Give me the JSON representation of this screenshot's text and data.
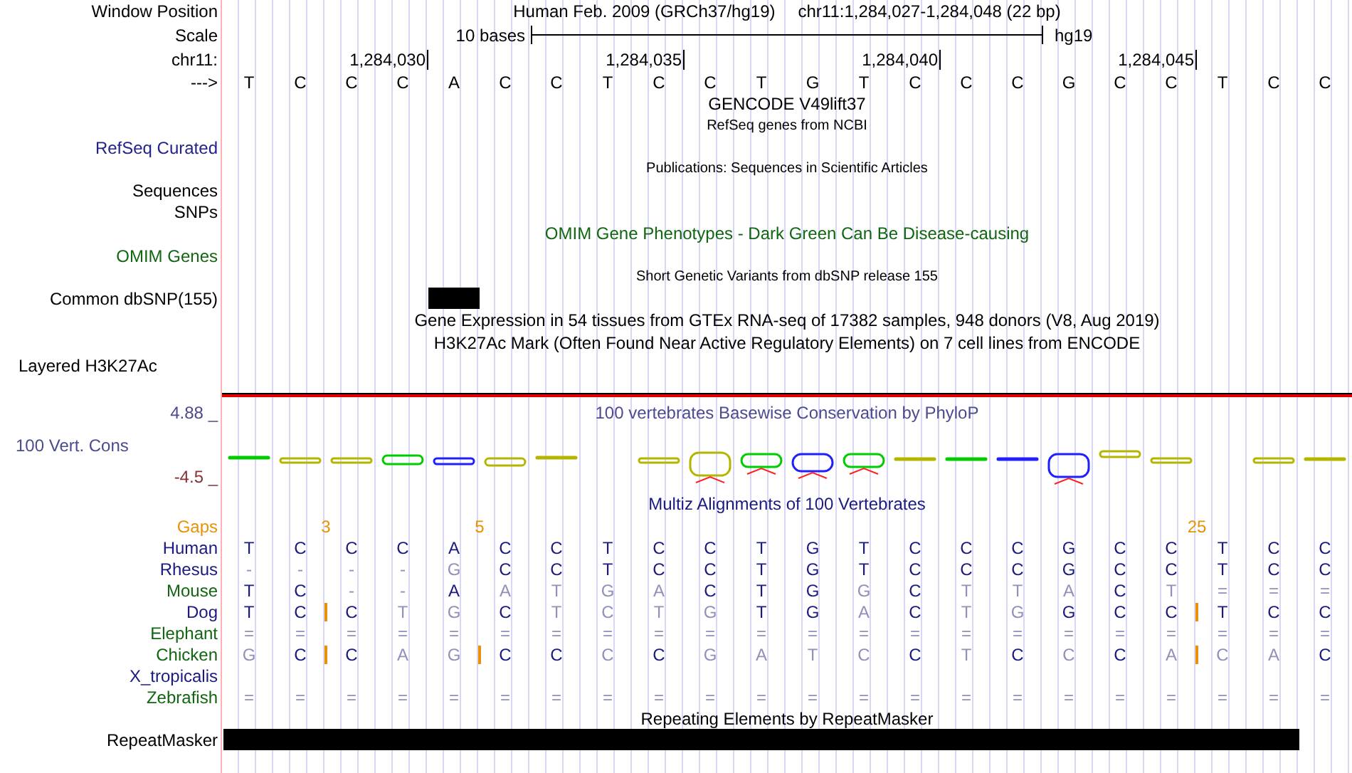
{
  "header": {
    "label": "Window Position",
    "assembly": "Human Feb. 2009 (GRCh37/hg19)",
    "location": "chr11:1,284,027-1,284,048 (22 bp)"
  },
  "scale": {
    "label": "Scale",
    "length": "10 bases",
    "assembly": "hg19"
  },
  "ruler": {
    "label": "chr11:"
  },
  "strand_label": "--->",
  "columns": [
    {
      "base": "T",
      "snp": false,
      "repeat": true
    },
    {
      "base": "C",
      "snp": false,
      "repeat": true
    },
    {
      "base": "C",
      "snp": false,
      "repeat": true,
      "gap_count": "3"
    },
    {
      "base": "C",
      "snp": false,
      "repeat": true,
      "tick": "1,284,030"
    },
    {
      "base": "A",
      "snp": true,
      "repeat": true
    },
    {
      "base": "C",
      "snp": false,
      "repeat": true,
      "gap_count": "5"
    },
    {
      "base": "C",
      "snp": false,
      "repeat": true
    },
    {
      "base": "T",
      "snp": false,
      "repeat": true
    },
    {
      "base": "C",
      "snp": false,
      "repeat": true,
      "tick": "1,284,035"
    },
    {
      "base": "C",
      "snp": false,
      "repeat": true
    },
    {
      "base": "T",
      "snp": false,
      "repeat": true
    },
    {
      "base": "G",
      "snp": false,
      "repeat": true
    },
    {
      "base": "T",
      "snp": false,
      "repeat": true
    },
    {
      "base": "C",
      "snp": false,
      "repeat": true,
      "tick": "1,284,040"
    },
    {
      "base": "C",
      "snp": false,
      "repeat": true
    },
    {
      "base": "C",
      "snp": false,
      "repeat": true
    },
    {
      "base": "G",
      "snp": false,
      "repeat": true
    },
    {
      "base": "C",
      "snp": false,
      "repeat": true
    },
    {
      "base": "C",
      "snp": false,
      "repeat": true,
      "tick": "1,284,045"
    },
    {
      "base": "T",
      "snp": false,
      "repeat": true,
      "gap_count": "25"
    },
    {
      "base": "C",
      "snp": false,
      "repeat": true
    },
    {
      "base": "C",
      "snp": false,
      "repeat": false
    }
  ],
  "tracks": [
    {
      "kind": "title",
      "text": "GENCODE V49lift37",
      "color": "#000000"
    },
    {
      "kind": "caption",
      "text": "RefSeq genes from NCBI"
    },
    {
      "kind": "label",
      "label": "RefSeq Curated",
      "color": "#22228c"
    },
    {
      "kind": "caption",
      "text": "Publications: Sequences in Scientific Articles"
    },
    {
      "kind": "label",
      "label": "Sequences",
      "color": "#000000"
    },
    {
      "kind": "label",
      "label": "SNPs",
      "color": "#000000"
    },
    {
      "kind": "title",
      "text": "OMIM Gene Phenotypes - Dark Green Can Be Disease-causing",
      "color": "#116611"
    },
    {
      "kind": "label",
      "label": "OMIM Genes",
      "color": "#116611"
    },
    {
      "kind": "caption",
      "text": "Short Genetic Variants from dbSNP release 155"
    },
    {
      "kind": "snp_track",
      "label": "Common dbSNP(155)",
      "color": "#000000"
    },
    {
      "kind": "title",
      "text": "Gene Expression in 54 tissues from GTEx RNA-seq of 17382 samples, 948 donors (V8, Aug 2019)",
      "color": "#000000"
    },
    {
      "kind": "title",
      "text": "H3K27Ac Mark (Often Found Near Active Regulatory Elements) on 7 cell lines from ENCODE",
      "color": "#000000"
    },
    {
      "kind": "group_label",
      "label": "Layered H3K27Ac",
      "color": "#000000"
    }
  ],
  "conservation": {
    "max": "4.88 _",
    "label": "100 Vert. Cons",
    "min": "-4.5 _",
    "title": "100 vertebrates Basewise Conservation by PhyloP"
  },
  "alignment": {
    "title": "Multiz Alignments of 100 Vertebrates",
    "gaps_label": "Gaps",
    "species": [
      {
        "name": "Human",
        "color": "#1a1a80",
        "bases": [
          {
            "base": "T",
            "match": true
          },
          {
            "base": "C",
            "match": true
          },
          {
            "base": "C",
            "match": true
          },
          {
            "base": "C",
            "match": true
          },
          {
            "base": "A",
            "match": true
          },
          {
            "base": "C",
            "match": true
          },
          {
            "base": "C",
            "match": true
          },
          {
            "base": "T",
            "match": true
          },
          {
            "base": "C",
            "match": true
          },
          {
            "base": "C",
            "match": true
          },
          {
            "base": "T",
            "match": true
          },
          {
            "base": "G",
            "match": true
          },
          {
            "base": "T",
            "match": true
          },
          {
            "base": "C",
            "match": true
          },
          {
            "base": "C",
            "match": true
          },
          {
            "base": "C",
            "match": true
          },
          {
            "base": "G",
            "match": true
          },
          {
            "base": "C",
            "match": true
          },
          {
            "base": "C",
            "match": true
          },
          {
            "base": "T",
            "match": true
          },
          {
            "base": "C",
            "match": true
          },
          {
            "base": "C",
            "match": true
          }
        ]
      },
      {
        "name": "Rhesus",
        "color": "#1a1a80",
        "bases": [
          {
            "base": "-",
            "match": false
          },
          {
            "base": "-",
            "match": false
          },
          {
            "base": "-",
            "match": false
          },
          {
            "base": "-",
            "match": false
          },
          {
            "base": "G",
            "match": false
          },
          {
            "base": "C",
            "match": true
          },
          {
            "base": "C",
            "match": true
          },
          {
            "base": "T",
            "match": true
          },
          {
            "base": "C",
            "match": true
          },
          {
            "base": "C",
            "match": true
          },
          {
            "base": "T",
            "match": true
          },
          {
            "base": "G",
            "match": true
          },
          {
            "base": "T",
            "match": true
          },
          {
            "base": "C",
            "match": true
          },
          {
            "base": "C",
            "match": true
          },
          {
            "base": "C",
            "match": true
          },
          {
            "base": "G",
            "match": true
          },
          {
            "base": "C",
            "match": true
          },
          {
            "base": "C",
            "match": true
          },
          {
            "base": "T",
            "match": true
          },
          {
            "base": "C",
            "match": true
          },
          {
            "base": "C",
            "match": true
          }
        ]
      },
      {
        "name": "Mouse",
        "color": "#116611",
        "bases": [
          {
            "base": "T",
            "match": true
          },
          {
            "base": "C",
            "match": true
          },
          {
            "base": "-",
            "match": false
          },
          {
            "base": "-",
            "match": false
          },
          {
            "base": "A",
            "match": true
          },
          {
            "base": "A",
            "match": false
          },
          {
            "base": "T",
            "match": false
          },
          {
            "base": "G",
            "match": false
          },
          {
            "base": "A",
            "match": false
          },
          {
            "base": "C",
            "match": true
          },
          {
            "base": "T",
            "match": true
          },
          {
            "base": "G",
            "match": true
          },
          {
            "base": "G",
            "match": false
          },
          {
            "base": "C",
            "match": true
          },
          {
            "base": "T",
            "match": false
          },
          {
            "base": "T",
            "match": false
          },
          {
            "base": "A",
            "match": false
          },
          {
            "base": "C",
            "match": true
          },
          {
            "base": "T",
            "match": false
          },
          {
            "base": "=",
            "match": false
          },
          {
            "base": "=",
            "match": false
          },
          {
            "base": "=",
            "match": false
          }
        ]
      },
      {
        "name": "Dog",
        "color": "#1a1a80",
        "bases": [
          {
            "base": "T",
            "match": true,
            "insert": false
          },
          {
            "base": "C",
            "match": true,
            "insert": false
          },
          {
            "base": "C",
            "match": true,
            "insert": true
          },
          {
            "base": "T",
            "match": false,
            "insert": false
          },
          {
            "base": "G",
            "match": false,
            "insert": false
          },
          {
            "base": "C",
            "match": true,
            "insert": false
          },
          {
            "base": "T",
            "match": false,
            "insert": false
          },
          {
            "base": "C",
            "match": false,
            "insert": false
          },
          {
            "base": "T",
            "match": false,
            "insert": false
          },
          {
            "base": "G",
            "match": false,
            "insert": false
          },
          {
            "base": "T",
            "match": true,
            "insert": false
          },
          {
            "base": "G",
            "match": true,
            "insert": false
          },
          {
            "base": "A",
            "match": false,
            "insert": false
          },
          {
            "base": "C",
            "match": true,
            "insert": false
          },
          {
            "base": "T",
            "match": false,
            "insert": false
          },
          {
            "base": "G",
            "match": false,
            "insert": false
          },
          {
            "base": "G",
            "match": true,
            "insert": false
          },
          {
            "base": "C",
            "match": true,
            "insert": false
          },
          {
            "base": "C",
            "match": true,
            "insert": false
          },
          {
            "base": "T",
            "match": true,
            "insert": true
          },
          {
            "base": "C",
            "match": true,
            "insert": false
          },
          {
            "base": "C",
            "match": true,
            "insert": false
          }
        ]
      },
      {
        "name": "Elephant",
        "color": "#116611",
        "bases": [
          {
            "base": "=",
            "match": false
          },
          {
            "base": "=",
            "match": false
          },
          {
            "base": "=",
            "match": false
          },
          {
            "base": "=",
            "match": false
          },
          {
            "base": "=",
            "match": false
          },
          {
            "base": "=",
            "match": false
          },
          {
            "base": "=",
            "match": false
          },
          {
            "base": "=",
            "match": false
          },
          {
            "base": "=",
            "match": false
          },
          {
            "base": "=",
            "match": false
          },
          {
            "base": "=",
            "match": false
          },
          {
            "base": "=",
            "match": false
          },
          {
            "base": "=",
            "match": false
          },
          {
            "base": "=",
            "match": false
          },
          {
            "base": "=",
            "match": false
          },
          {
            "base": "=",
            "match": false
          },
          {
            "base": "=",
            "match": false
          },
          {
            "base": "=",
            "match": false
          },
          {
            "base": "=",
            "match": false
          },
          {
            "base": "=",
            "match": false
          },
          {
            "base": "=",
            "match": false
          },
          {
            "base": "=",
            "match": false
          }
        ]
      },
      {
        "name": "Chicken",
        "color": "#116611",
        "bases": [
          {
            "base": "G",
            "match": false,
            "insert": false
          },
          {
            "base": "C",
            "match": true,
            "insert": false
          },
          {
            "base": "C",
            "match": true,
            "insert": true
          },
          {
            "base": "A",
            "match": false,
            "insert": false
          },
          {
            "base": "G",
            "match": false,
            "insert": false
          },
          {
            "base": "C",
            "match": true,
            "insert": true
          },
          {
            "base": "C",
            "match": true,
            "insert": false
          },
          {
            "base": "C",
            "match": false,
            "insert": false
          },
          {
            "base": "C",
            "match": true,
            "insert": false
          },
          {
            "base": "G",
            "match": false,
            "insert": false
          },
          {
            "base": "A",
            "match": false,
            "insert": false
          },
          {
            "base": "T",
            "match": false,
            "insert": false
          },
          {
            "base": "C",
            "match": false,
            "insert": false
          },
          {
            "base": "C",
            "match": true,
            "insert": false
          },
          {
            "base": "T",
            "match": false,
            "insert": false
          },
          {
            "base": "C",
            "match": true,
            "insert": false
          },
          {
            "base": "C",
            "match": false,
            "insert": false
          },
          {
            "base": "C",
            "match": true,
            "insert": false
          },
          {
            "base": "A",
            "match": false,
            "insert": false
          },
          {
            "base": "C",
            "match": false,
            "insert": true
          },
          {
            "base": "A",
            "match": false,
            "insert": false
          },
          {
            "base": "C",
            "match": true,
            "insert": false
          }
        ]
      },
      {
        "name": "X_tropicalis",
        "color": "#1a1a80"
      },
      {
        "name": "Zebrafish",
        "color": "#116611",
        "bases": [
          {
            "base": "=",
            "match": false
          },
          {
            "base": "=",
            "match": false
          },
          {
            "base": "=",
            "match": false
          },
          {
            "base": "=",
            "match": false
          },
          {
            "base": "=",
            "match": false
          },
          {
            "base": "=",
            "match": false
          },
          {
            "base": "=",
            "match": false
          },
          {
            "base": "=",
            "match": false
          },
          {
            "base": "=",
            "match": false
          },
          {
            "base": "=",
            "match": false
          },
          {
            "base": "=",
            "match": false
          },
          {
            "base": "=",
            "match": false
          },
          {
            "base": "=",
            "match": false
          },
          {
            "base": "=",
            "match": false
          },
          {
            "base": "=",
            "match": false
          },
          {
            "base": "=",
            "match": false
          },
          {
            "base": "=",
            "match": false
          },
          {
            "base": "=",
            "match": false
          },
          {
            "base": "=",
            "match": false
          },
          {
            "base": "=",
            "match": false
          },
          {
            "base": "=",
            "match": false
          },
          {
            "base": "=",
            "match": false
          }
        ]
      }
    ]
  },
  "repeats": {
    "title": "Repeating Elements by RepeatMasker",
    "label": "RepeatMasker"
  }
}
